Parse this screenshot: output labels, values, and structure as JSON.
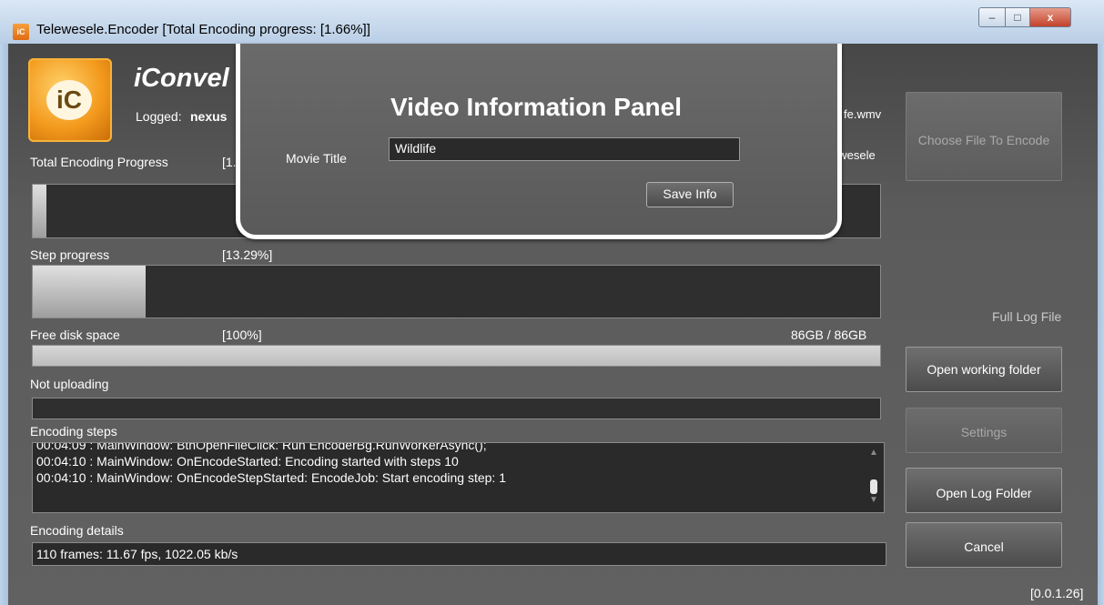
{
  "window": {
    "title": "Telewesele.Encoder [Total Encoding progress: [1.66%]]",
    "icon_text": "iC",
    "controls": {
      "minimize": "–",
      "maximize": "□",
      "close": "x"
    }
  },
  "header": {
    "brand": "iConvel",
    "logged_label": "Logged:",
    "logged_user": "nexus",
    "file_name_fragment": "fe.wmv",
    "folder_fragment": "ewesele",
    "app_icon_text": "iC"
  },
  "progress": {
    "total": {
      "label": "Total Encoding Progress",
      "value_text": "[1.",
      "fraction": 0.0166
    },
    "step": {
      "label": "Step progress",
      "value_text": "[13.29%]",
      "fraction": 0.1329
    },
    "disk": {
      "label": "Free disk space",
      "value_text": "[100%]",
      "right_text": "86GB / 86GB",
      "fraction": 1.0
    },
    "upload": {
      "label": "Not uploading",
      "fraction": 0
    }
  },
  "steps": {
    "label": "Encoding steps",
    "lines": [
      "00:04:09 : MainWindow: BtnOpenFileClick: Run EncoderBg.RunWorkerAsync();",
      "00:04:10 : MainWindow: OnEncodeStarted: Encoding started with steps 10",
      "00:04:10 : MainWindow: OnEncodeStepStarted: EncodeJob: Start encoding step: 1"
    ]
  },
  "details": {
    "label": "Encoding details",
    "value": "110 frames: 11.67 fps, 1022.05 kb/s"
  },
  "sidebar": {
    "choose_file": "Choose File To Encode",
    "full_log": "Full Log File",
    "open_working": "Open working folder",
    "settings": "Settings",
    "open_log": "Open Log Folder",
    "cancel": "Cancel"
  },
  "version": "[0.0.1.26]",
  "panel": {
    "title": "Video Information Panel",
    "movie_title_label": "Movie Title",
    "movie_title_value": "Wildlife",
    "save_label": "Save Info"
  }
}
